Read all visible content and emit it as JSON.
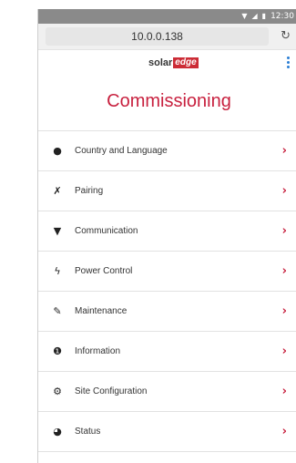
{
  "status_bar": {
    "time": "12:30",
    "icons": [
      "wifi-icon",
      "signal-icon",
      "battery-icon"
    ]
  },
  "browser": {
    "url": "10.0.0.138",
    "reload_icon": "reload-icon"
  },
  "brand": {
    "logo_prefix": "solar",
    "logo_suffix": "edge",
    "menu_icon": "kebab-menu-icon"
  },
  "page": {
    "title": "Commissioning"
  },
  "menu": {
    "items": [
      {
        "label": "Country and Language",
        "icon": "globe-icon"
      },
      {
        "label": "Pairing",
        "icon": "pairing-icon"
      },
      {
        "label": "Communication",
        "icon": "wifi-icon"
      },
      {
        "label": "Power Control",
        "icon": "lightning-icon"
      },
      {
        "label": "Maintenance",
        "icon": "wrench-icon"
      },
      {
        "label": "Information",
        "icon": "info-icon"
      },
      {
        "label": "Site Configuration",
        "icon": "gears-icon"
      },
      {
        "label": "Status",
        "icon": "tachometer-icon"
      }
    ],
    "chevron_icon": "chevron-right-icon"
  },
  "colors": {
    "accent": "#c8213f",
    "logo_red": "#cc2c36",
    "kebab_blue": "#2a7fd4",
    "status_bar": "#8a8a8a"
  }
}
